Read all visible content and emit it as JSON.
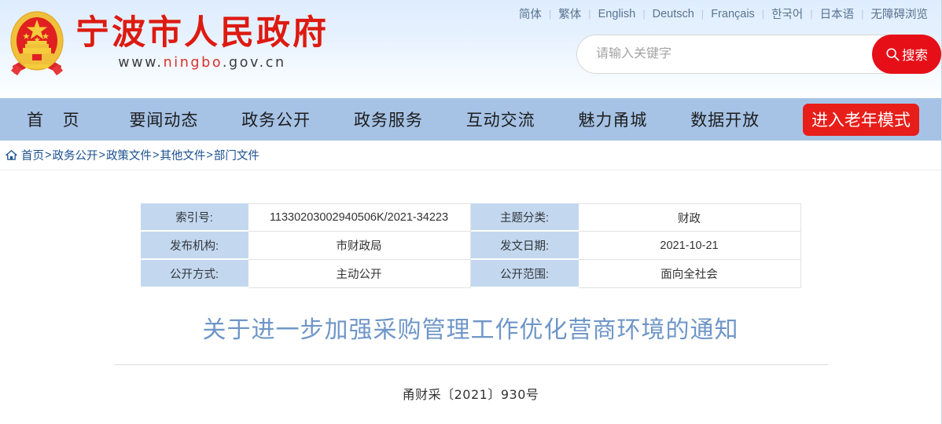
{
  "header": {
    "site_title": "宁波市人民政府",
    "site_url_prefix": "www.",
    "site_url_domain": "ningbo",
    "site_url_suffix": ".gov.cn",
    "emblem_name": "national-emblem-of-china",
    "languages": [
      "简体",
      "繁体",
      "English",
      "Deutsch",
      "Français",
      "한국어",
      "日本语",
      "无障碍浏览"
    ],
    "search": {
      "placeholder": "请输入关键字",
      "value": "",
      "button_label": "搜索",
      "button_color": "#e60f18"
    }
  },
  "nav": {
    "items": [
      "首 页",
      "要闻动态",
      "政务公开",
      "政务服务",
      "互动交流",
      "魅力甬城",
      "数据开放"
    ],
    "elder_mode_label": "进入老年模式",
    "background_color": "#a6c3e6",
    "elder_mode_color": "#e71e19"
  },
  "breadcrumb": {
    "items": [
      "首页",
      "政务公开",
      "政策文件",
      "其他文件",
      "部门文件"
    ],
    "separator": ">"
  },
  "doc_meta": {
    "rows": [
      {
        "label_left": "索引号:",
        "value_left": "11330203002940506K/2021-34223",
        "label_right": "主题分类:",
        "value_right": "财政"
      },
      {
        "label_left": "发布机构:",
        "value_left": "市财政局",
        "label_right": "发文日期:",
        "value_right": "2021-10-21"
      },
      {
        "label_left": "公开方式:",
        "value_left": "主动公开",
        "label_right": "公开范围:",
        "value_right": "面向全社会"
      }
    ],
    "label_background": "#c3d8ef"
  },
  "document": {
    "title": "关于进一步加强采购管理工作优化营商环境的通知",
    "title_color": "#6f96c8",
    "number": "甬财采〔2021〕930号"
  }
}
